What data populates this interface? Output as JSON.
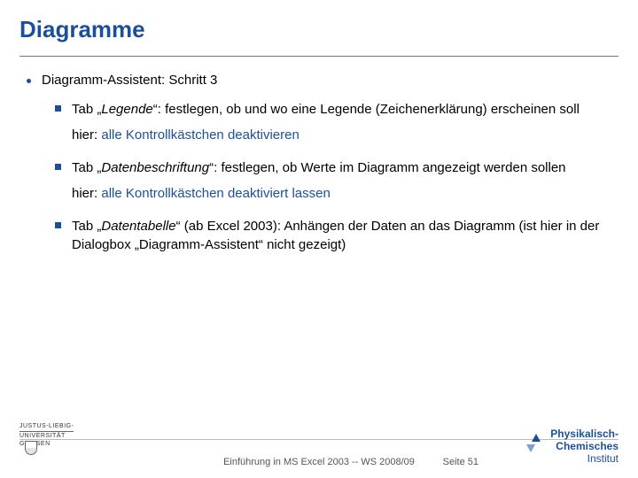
{
  "title": "Diagramme",
  "level1": "Diagramm-Assistent: Schritt 3",
  "items": [
    {
      "pre": "Tab „",
      "em": "Legende",
      "post": "“: festlegen, ob und wo eine Legende (Zeichenerklärung) erscheinen soll",
      "hint_prefix": "hier: ",
      "hint": "alle Kontrollkästchen deaktivieren"
    },
    {
      "pre": "Tab „",
      "em": "Datenbeschriftung",
      "post": "“: festlegen, ob Werte im Diagramm angezeigt werden sollen",
      "hint_prefix": "hier: ",
      "hint": "alle Kontrollkästchen deaktiviert lassen"
    },
    {
      "pre": "Tab „",
      "em": "Datentabelle",
      "post": "“ (ab Excel 2003): Anhängen der Daten an das Diagramm (ist hier in der Dialogbox „Diagramm-Assistent“ nicht gezeigt)",
      "hint_prefix": "",
      "hint": ""
    }
  ],
  "footer": {
    "uni1": "JUSTUS-LIEBIG-",
    "uni2": "UNIVERSITÄT",
    "uni3": "GIESSEN",
    "center": "Einführung in MS Excel 2003  --  WS 2008/09",
    "page": "Seite 51",
    "inst1": "Physikalisch-",
    "inst2": "Chemisches",
    "inst3": "Institut"
  }
}
